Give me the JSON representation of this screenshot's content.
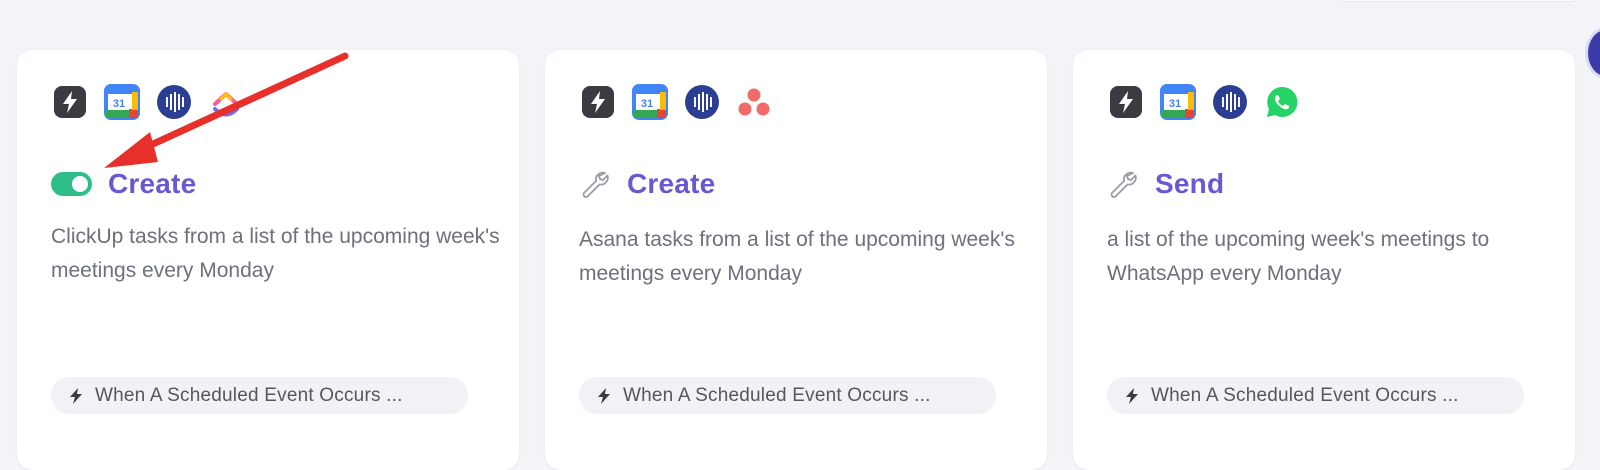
{
  "cards": [
    {
      "apps": [
        "bolt-icon",
        "google-calendar-icon",
        "audio-wave-icon",
        "clickup-icon"
      ],
      "status": "toggle-on",
      "title": "Create",
      "description": "ClickUp tasks from a list of the upcoming week's meetings every Monday",
      "trigger": "When A Scheduled Event Occurs ..."
    },
    {
      "apps": [
        "bolt-icon",
        "google-calendar-icon",
        "audio-wave-icon",
        "asana-icon"
      ],
      "status": "wrench",
      "title": "Create",
      "description": "Asana tasks from a list of the upcoming week's meetings every Monday",
      "trigger": "When A Scheduled Event Occurs ..."
    },
    {
      "apps": [
        "bolt-icon",
        "google-calendar-icon",
        "audio-wave-icon",
        "whatsapp-icon"
      ],
      "status": "wrench",
      "title": "Send",
      "description": "a list of the upcoming week's meetings to WhatsApp every Monday",
      "trigger": "When A Scheduled Event Occurs ..."
    }
  ],
  "calendar_day": "31",
  "colors": {
    "accent": "#6b57d2",
    "toggle_on": "#2fbe8a",
    "annotation": "#e8302a",
    "text_muted": "#6e707a"
  }
}
